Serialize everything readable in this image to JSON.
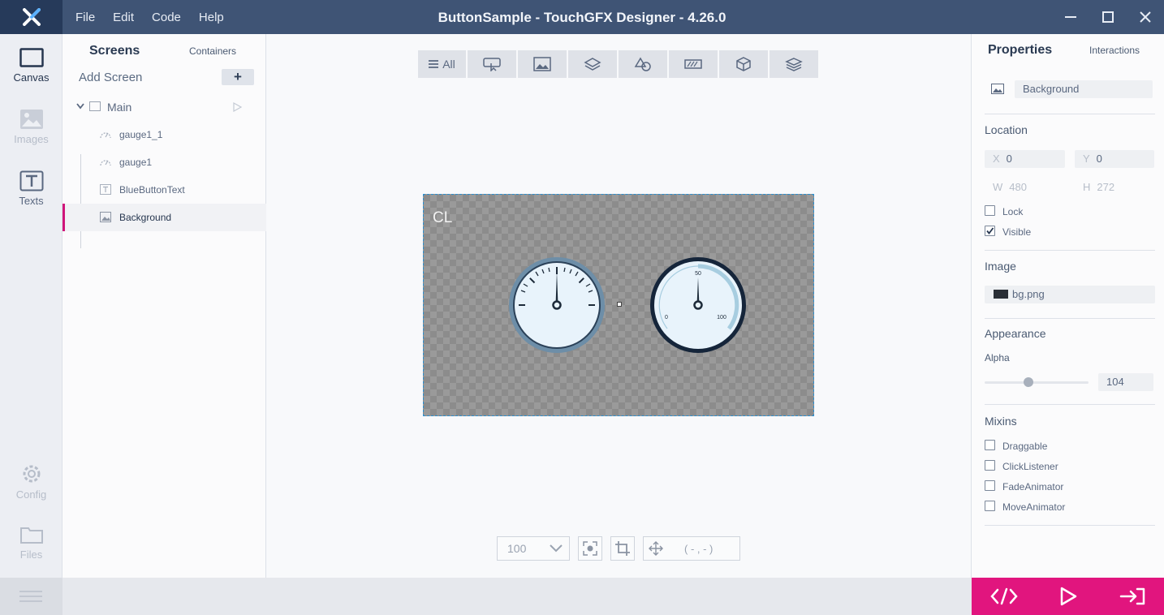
{
  "app": {
    "title": "ButtonSample - TouchGFX Designer - 4.26.0",
    "menu": [
      "File",
      "Edit",
      "Code",
      "Help"
    ]
  },
  "rail": {
    "items": [
      {
        "label": "Canvas",
        "icon": "canvas-icon",
        "state": "active"
      },
      {
        "label": "Images",
        "icon": "image-icon",
        "state": "dim"
      },
      {
        "label": "Texts",
        "icon": "text-icon",
        "state": "mid"
      },
      {
        "label": "Config",
        "icon": "gear-icon",
        "state": "dim"
      },
      {
        "label": "Files",
        "icon": "folder-icon",
        "state": "dim"
      }
    ]
  },
  "screens_panel": {
    "tab_screens": "Screens",
    "tab_containers": "Containers",
    "add_screen": "Add Screen",
    "add_button": "+",
    "screen_name": "Main",
    "widgets": [
      {
        "label": "gauge1_1",
        "icon": "gauge-icon"
      },
      {
        "label": "gauge1",
        "icon": "gauge-icon"
      },
      {
        "label": "BlueButtonText",
        "icon": "text-widget-icon"
      },
      {
        "label": "Background",
        "icon": "image-widget-icon",
        "selected": true
      }
    ]
  },
  "canvas": {
    "filter_all": "All",
    "stage_label": "CL",
    "zoom": "100",
    "coords": "( - , - )",
    "gauge2_labels": {
      "min": "0",
      "mid": "50",
      "max": "100"
    }
  },
  "properties": {
    "tab_properties": "Properties",
    "tab_interactions": "Interactions",
    "widget_name": "Background",
    "location_header": "Location",
    "x_label": "X",
    "x": "0",
    "y_label": "Y",
    "y": "0",
    "w_label": "W",
    "w": "480",
    "h_label": "H",
    "h": "272",
    "lock_label": "Lock",
    "lock": false,
    "visible_label": "Visible",
    "visible": true,
    "image_header": "Image",
    "image_file": "bg.png",
    "appearance_header": "Appearance",
    "alpha_label": "Alpha",
    "alpha_value": "104",
    "mixins_header": "Mixins",
    "mixins": [
      "Draggable",
      "ClickListener",
      "FadeAnimator",
      "MoveAnimator"
    ]
  },
  "colors": {
    "titlebar": "#3f5475",
    "accent": "#e1157e",
    "selection": "#2a8fd0"
  }
}
